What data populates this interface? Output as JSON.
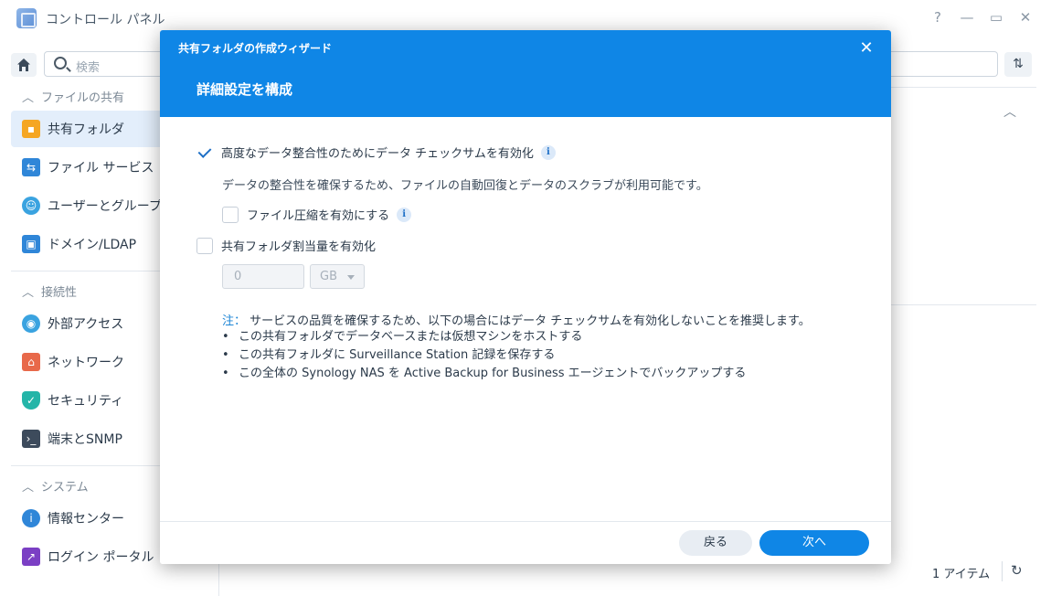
{
  "window": {
    "title": "コントロール パネル",
    "controls": [
      "?",
      "—",
      "▭",
      "✕"
    ]
  },
  "toolbar": {
    "search_placeholder": "検索"
  },
  "sidebar": {
    "sections": [
      {
        "header": "ファイルの共有",
        "items": [
          {
            "label": "共有フォルダ",
            "icon": "folder-share-icon",
            "active": true
          },
          {
            "label": "ファイル サービス",
            "icon": "file-services-icon"
          },
          {
            "label": "ユーザーとグループ",
            "icon": "users-groups-icon"
          },
          {
            "label": "ドメイン/LDAP",
            "icon": "domain-ldap-icon"
          }
        ]
      },
      {
        "header": "接続性",
        "items": [
          {
            "label": "外部アクセス",
            "icon": "external-access-icon"
          },
          {
            "label": "ネットワーク",
            "icon": "network-icon"
          },
          {
            "label": "セキュリティ",
            "icon": "security-shield-icon"
          },
          {
            "label": "端末とSNMP",
            "icon": "terminal-icon"
          }
        ]
      },
      {
        "header": "システム",
        "items": [
          {
            "label": "情報センター",
            "icon": "info-center-icon"
          },
          {
            "label": "ログイン ポータル",
            "icon": "login-portal-icon"
          }
        ]
      }
    ]
  },
  "main": {
    "item_count": "1 アイテム"
  },
  "dialog": {
    "wizard_title": "共有フォルダの作成ウィザード",
    "step_title": "詳細設定を構成",
    "options": {
      "checksum": {
        "label": "高度なデータ整合性のためにデータ チェックサムを有効化",
        "checked": true
      },
      "checksum_desc": "データの整合性を確保するため、ファイルの自動回復とデータのスクラブが利用可能です。",
      "compression": {
        "label": "ファイル圧縮を有効にする",
        "checked": false
      },
      "quota": {
        "label": "共有フォルダ割当量を有効化",
        "checked": false
      }
    },
    "quota_value": "0",
    "quota_unit": "GB",
    "note_prefix": "注：",
    "note_text": "サービスの品質を確保するため、以下の場合にはデータ チェックサムを有効化しないことを推奨します。",
    "bullets": [
      "この共有フォルダでデータベースまたは仮想マシンをホストする",
      "この共有フォルダに Surveillance Station 記録を保存する",
      "この全体の Synology NAS を Active Backup for Business エージェントでバックアップする"
    ],
    "buttons": {
      "back": "戻る",
      "next": "次へ"
    }
  }
}
